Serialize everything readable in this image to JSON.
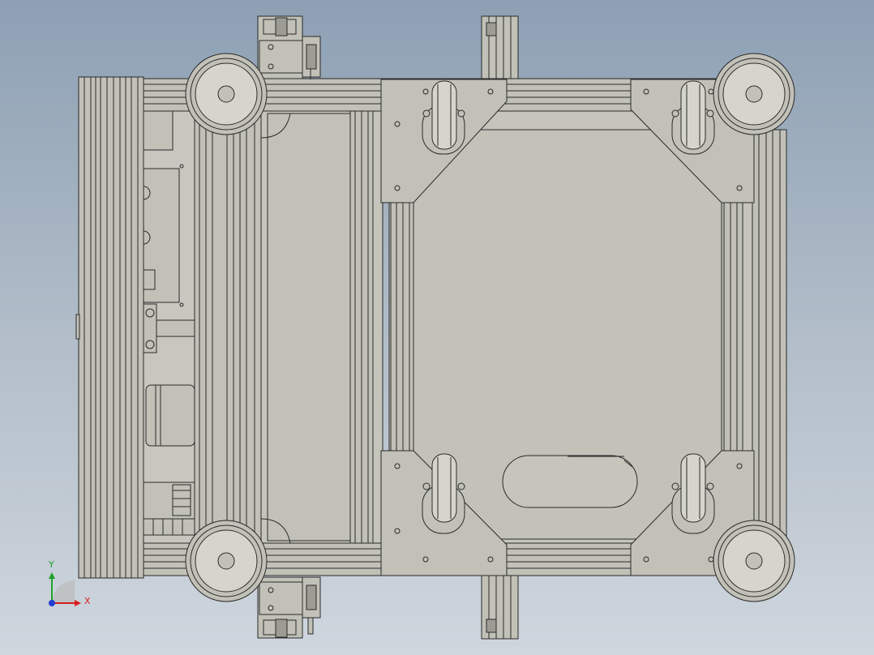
{
  "colors": {
    "background_top": "#8da0b4",
    "background_bottom": "#cfd6de",
    "metal": "#c2c1b8",
    "metal_light": "#d6d5cc",
    "line": "#2a2a2a",
    "axis_x": "#d61f1f",
    "axis_y": "#1fa32b",
    "axis_origin": "#1e3fd0"
  },
  "triad": {
    "x_label": "X",
    "y_label": "Y"
  },
  "icons": [
    "coordinate-triad-icon"
  ]
}
